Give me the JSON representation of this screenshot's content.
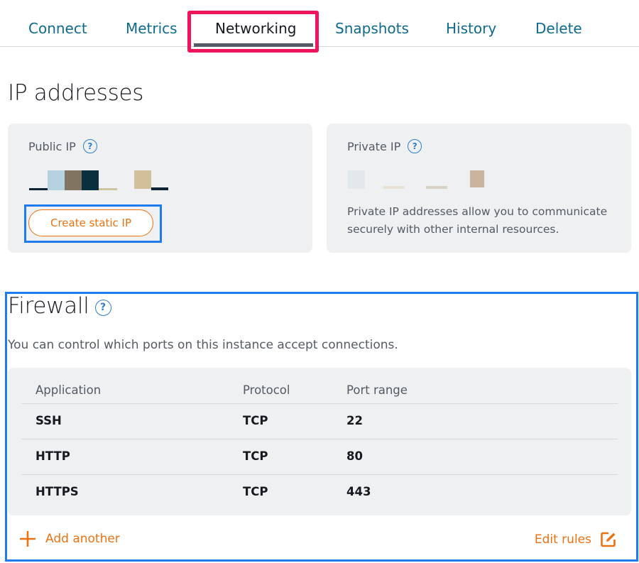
{
  "tabs": [
    {
      "label": "Connect"
    },
    {
      "label": "Metrics"
    },
    {
      "label": "Networking"
    },
    {
      "label": "Snapshots"
    },
    {
      "label": "History"
    },
    {
      "label": "Delete"
    }
  ],
  "active_tab": "Networking",
  "ip_section": {
    "heading": "IP addresses",
    "public": {
      "label": "Public IP",
      "create_button": "Create static IP"
    },
    "private": {
      "label": "Private IP",
      "description": "Private IP addresses allow you to communicate securely with other internal resources."
    }
  },
  "firewall": {
    "heading": "Firewall",
    "description": "You can control which ports on this instance accept connections.",
    "columns": [
      "Application",
      "Protocol",
      "Port range"
    ],
    "rows": [
      {
        "application": "SSH",
        "protocol": "TCP",
        "port": "22"
      },
      {
        "application": "HTTP",
        "protocol": "TCP",
        "port": "80"
      },
      {
        "application": "HTTPS",
        "protocol": "TCP",
        "port": "443"
      }
    ],
    "add_label": "Add another",
    "edit_label": "Edit rules"
  },
  "colors": {
    "link": "#0e6a8e",
    "accent_orange": "#ec7211",
    "help_blue": "#2f7ec8",
    "highlight_pink": "#f0145a",
    "highlight_blue": "#1f7bf0",
    "card_bg": "#eef0f1"
  },
  "icons": {
    "help": "question-circle-icon",
    "add": "plus-icon",
    "edit": "edit-icon"
  }
}
